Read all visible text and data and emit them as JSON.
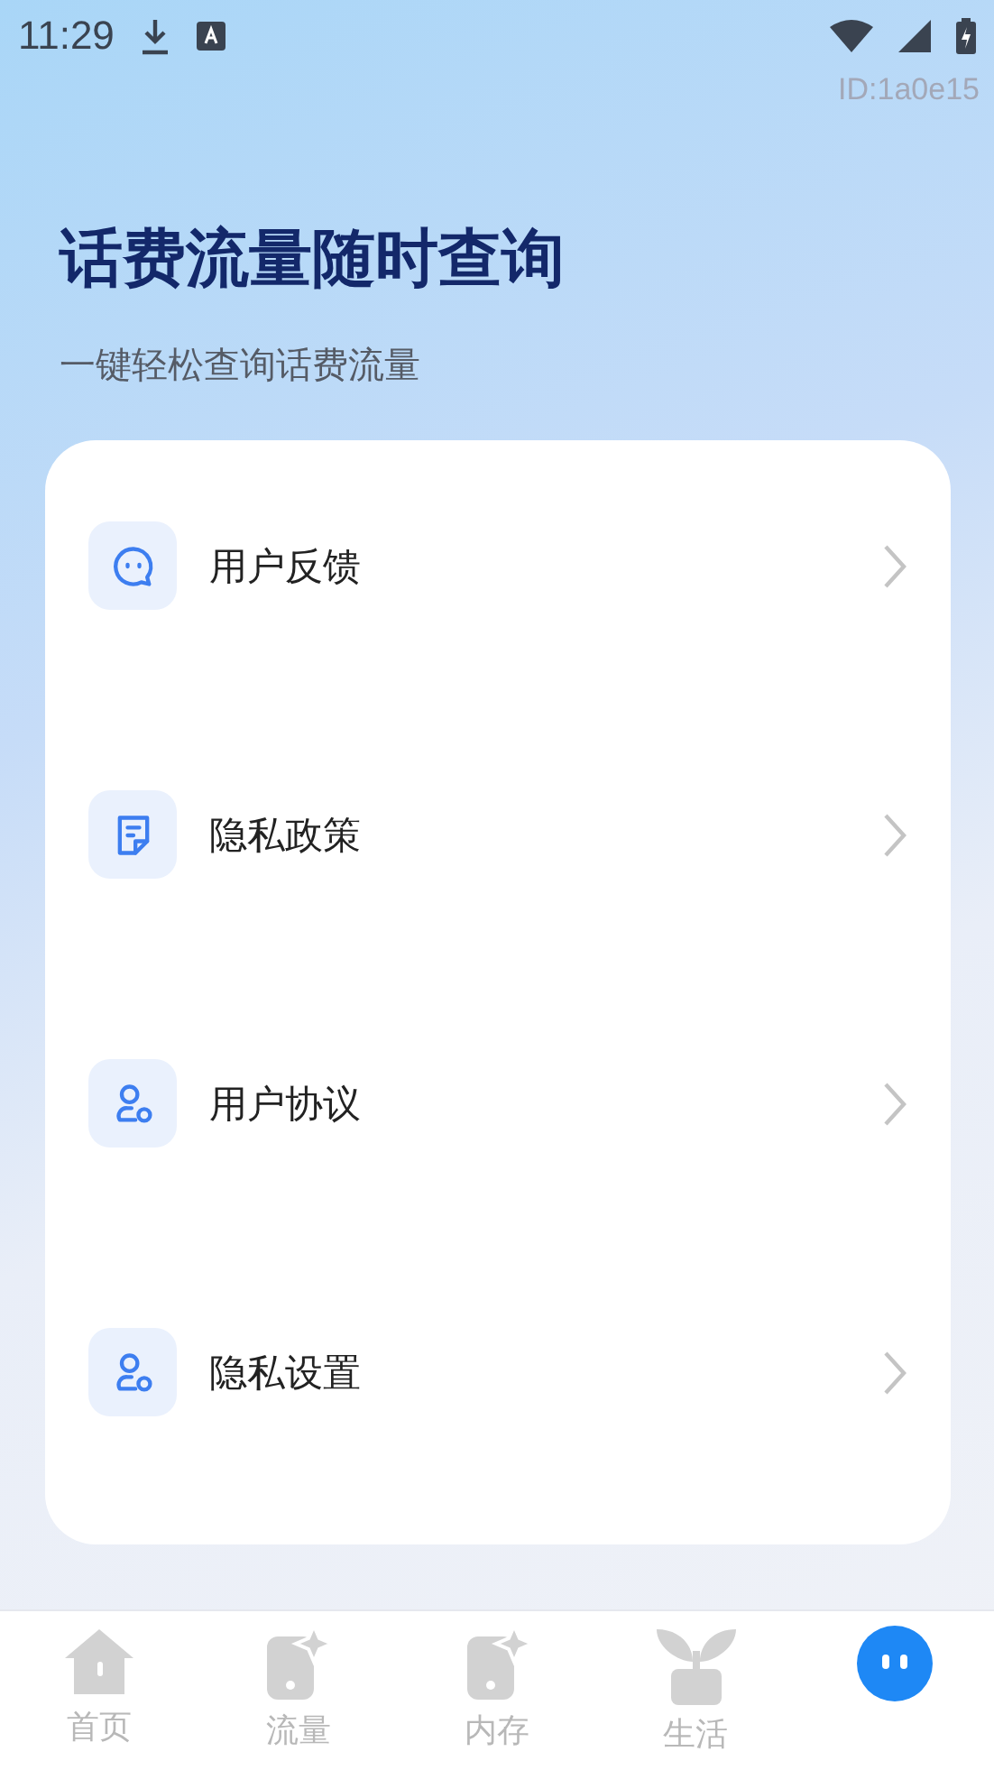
{
  "status_bar": {
    "time": "11:29"
  },
  "account_id": "ID:1a0e15",
  "header": {
    "title": "话费流量随时查询",
    "subtitle": "一键轻松查询话费流量"
  },
  "menu": [
    {
      "label": "用户反馈",
      "kind": "chat"
    },
    {
      "label": "隐私政策",
      "kind": "document"
    },
    {
      "label": "用户协议",
      "kind": "user"
    },
    {
      "label": "隐私设置",
      "kind": "user"
    }
  ],
  "tabs": [
    {
      "label": "首页",
      "kind": "home",
      "selected": false
    },
    {
      "label": "流量",
      "kind": "phone",
      "selected": false
    },
    {
      "label": "内存",
      "kind": "phone",
      "selected": false
    },
    {
      "label": "生活",
      "kind": "plant",
      "selected": false
    },
    {
      "kind": "face",
      "selected": true
    }
  ]
}
